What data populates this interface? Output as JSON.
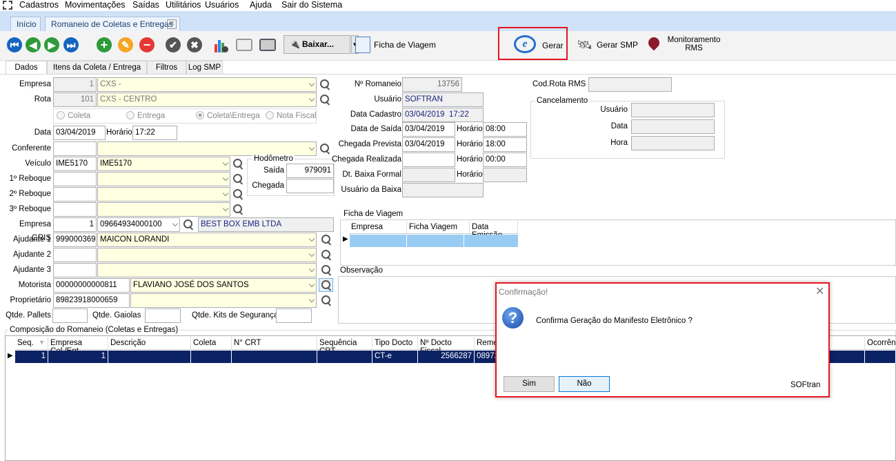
{
  "menu": {
    "items": [
      "Cadastros",
      "Movimentações",
      "Saídas",
      "Utilitários",
      "Usuários",
      "Ajuda",
      "Sair do Sistema"
    ]
  },
  "tabs": {
    "home": "Início",
    "romaneio": "Romaneio de Coletas e Entregas"
  },
  "toolbar": {
    "baixar": "Baixar...",
    "ficha_viagem": "Ficha de Viagem",
    "gerar": "Gerar",
    "gerar_smp": "Gerar SMP",
    "monitoramento": "Monitoramento",
    "rms": "RMS",
    "highlight_color": "#e8141e"
  },
  "subtabs": [
    "Dados",
    "Itens da Coleta / Entrega",
    "Filtros",
    "Log SMP"
  ],
  "form": {
    "empresa": {
      "label": "Empresa",
      "code": "1",
      "name": "CXS -"
    },
    "rota": {
      "label": "Rota",
      "code": "101",
      "name": "CXS - CENTRO"
    },
    "radios": [
      "Coleta",
      "Entrega",
      "Coleta\\Entrega",
      "Nota Fiscal"
    ],
    "radio_selected": "Coleta\\Entrega",
    "data": {
      "label": "Data",
      "value": "03/04/2019",
      "horario_label": "Horário",
      "horario": "17:22"
    },
    "conferente": {
      "label": "Conferente",
      "code": "",
      "name": ""
    },
    "veiculo": {
      "label": "Veículo",
      "code": "IME5170",
      "name": "IME5170"
    },
    "reboque1": {
      "label": "1º Reboque"
    },
    "reboque2": {
      "label": "2º Reboque"
    },
    "reboque3": {
      "label": "3º Reboque"
    },
    "hodometro": {
      "label": "Hodômetro",
      "saida_label": "Saída",
      "saida": "979091",
      "chegada_label": "Chegada",
      "chegada": ""
    },
    "empresa_gris": {
      "label": "Empresa GRIS",
      "code": "1",
      "cnpj": "09664934000100",
      "name": "BEST BOX EMB LTDA"
    },
    "ajudante1": {
      "label": "Ajudante 1",
      "code": "999000369",
      "name": "MAICON LORANDI"
    },
    "ajudante2": {
      "label": "Ajudante 2"
    },
    "ajudante3": {
      "label": "Ajudante 3"
    },
    "motorista": {
      "label": "Motorista",
      "code": "00000000000811",
      "name": "FLAVIANO JOSÉ DOS SANTOS"
    },
    "proprietario": {
      "label": "Proprietário",
      "code": "89823918000659",
      "name": ""
    },
    "qtde_pallets": "Qtde. Pallets",
    "qtde_gaiolas": "Qtde. Gaiolas",
    "qtde_kits": "Qtde. Kits de Segurança",
    "n_romaneio": {
      "label": "Nº Romaneio",
      "value": "13756"
    },
    "usuario": {
      "label": "Usuário",
      "value": "SOFTRAN"
    },
    "data_cadastro": {
      "label": "Data Cadastro",
      "value": "03/04/2019  17:22"
    },
    "data_saida": {
      "label": "Data de Saída",
      "value": "03/04/2019",
      "hora": "08:00"
    },
    "chegada_prevista": {
      "label": "Chegada Prevista",
      "value": "03/04/2019",
      "hora": "18:00"
    },
    "chegada_realizada": {
      "label": "Chegada Realizada",
      "value": "",
      "hora": "00:00"
    },
    "dt_baixa": {
      "label": "Dt. Baixa Formal"
    },
    "usuario_baixa": {
      "label": "Usuário da Baixa"
    },
    "horario": "Horário",
    "cod_rota_rms": "Cod.Rota RMS",
    "cancelamento": {
      "label": "Cancelamento",
      "usuario": "Usuário",
      "data": "Data",
      "hora": "Hora"
    },
    "ficha": {
      "label": "Ficha de Viagem",
      "columns": [
        "Empresa",
        "Ficha Viagem",
        "Data Emissão"
      ]
    },
    "observacao": "Observação"
  },
  "composicao": {
    "label": "Composição do Romaneio (Coletas e Entregas)",
    "columns": [
      "Seq.",
      "Empresa Col./Ent.",
      "Descrição",
      "Coleta",
      "N° CRT",
      "Sequência CRT",
      "Tipo Docto",
      "Nº Docto Fiscal",
      "Remet",
      "Ocorrênc"
    ],
    "rows": [
      {
        "seq": "1",
        "empresa": "1",
        "descricao": "",
        "coleta": "",
        "crt": "",
        "seq_crt": "",
        "tipo": "CT-e",
        "docto": "2566287",
        "remet": "08972"
      }
    ]
  },
  "dialog": {
    "title": "Confirmação!",
    "message": "Confirma Geração do Manifesto Eletrônico ?",
    "yes": "Sim",
    "no": "Não",
    "brand": "SOFtran"
  }
}
